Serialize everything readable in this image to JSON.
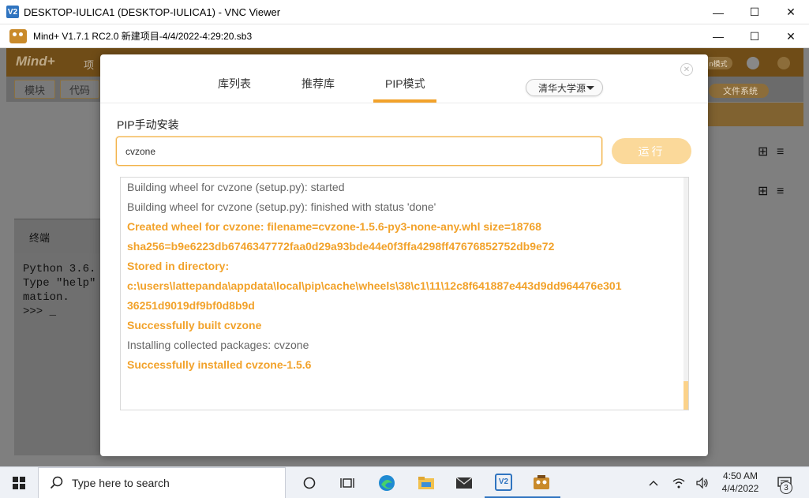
{
  "vnc_window": {
    "icon_text": "V2",
    "title": "DESKTOP-IULICA1 (DESKTOP-IULICA1) - VNC Viewer",
    "minimize": "—",
    "maximize": "☐",
    "close": "✕"
  },
  "mind_window": {
    "title": "Mind+ V1.7.1 RC2.0  新建项目-4/4/2022-4:29:20.sb3",
    "minimize": "—",
    "maximize": "☐",
    "close": "✕"
  },
  "app_background": {
    "logo": "Mind+",
    "menu_fragment": "项",
    "tab_blocks": "模块",
    "tab_code": "代码",
    "mode_pill": "n模式",
    "file_system": "文件系统",
    "terminal_label": "终端",
    "terminal_lines": [
      "Python 3.6.",
      "Type \"help\"",
      "mation.",
      ">>> _"
    ]
  },
  "modal": {
    "tabs": [
      "库列表",
      "推荐库",
      "PIP模式"
    ],
    "active_tab": "PIP模式",
    "mirror_select": "清华大学源",
    "manual_install_label": "PIP手动安装",
    "input_value": "cvzone",
    "run_button": "运行",
    "log": [
      {
        "text": "  Building wheel for cvzone (setup.py): started",
        "style": "gray"
      },
      {
        "text": "  Building wheel for cvzone (setup.py): finished with status 'done'",
        "style": "gray"
      },
      {
        "text": "  Created wheel for cvzone: filename=cvzone-1.5.6-py3-none-any.whl size=18768",
        "style": "orange"
      },
      {
        "text": "sha256=b9e6223db6746347772faa0d29a93bde44e0f3ffa4298ff47676852752db9e72",
        "style": "orange"
      },
      {
        "text": "  Stored in directory:",
        "style": "orange"
      },
      {
        "text": "c:\\users\\lattepanda\\appdata\\local\\pip\\cache\\wheels\\38\\c1\\11\\12c8f641887e443d9dd964476e301",
        "style": "orange"
      },
      {
        "text": "36251d9019df9bf0d8b9d",
        "style": "orange"
      },
      {
        "text": "Successfully built cvzone",
        "style": "orange"
      },
      {
        "text": "Installing collected packages: cvzone",
        "style": "gray"
      },
      {
        "text": "Successfully installed cvzone-1.5.6",
        "style": "orange"
      }
    ]
  },
  "taskbar": {
    "search_placeholder": "Type here to search",
    "time": "4:50 AM",
    "date": "4/4/2022",
    "notification_count": "3",
    "vnc_icon_text": "V2"
  },
  "colors": {
    "accent_orange": "#f2a22a",
    "run_button_disabled": "#fbd99a",
    "windows_blue": "#2f74c0"
  }
}
